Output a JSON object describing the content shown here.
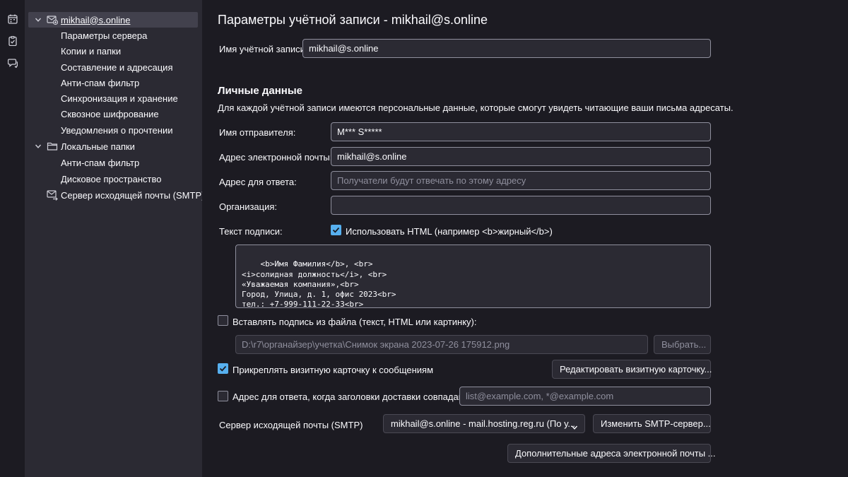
{
  "spaces": {
    "icons": [
      "calendar-icon",
      "tasks-icon",
      "chat-icon"
    ]
  },
  "tree": {
    "account": "mikhail@s.online",
    "account_items": [
      "Параметры сервера",
      "Копии и папки",
      "Составление и адресация",
      "Анти-спам фильтр",
      "Синхронизация и хранение",
      "Сквозное шифрование",
      "Уведомления о прочтении"
    ],
    "local_folders": "Локальные папки",
    "local_items": [
      "Анти-спам фильтр",
      "Дисковое пространство"
    ],
    "smtp": "Сервер исходящей почты (SMTP)"
  },
  "main": {
    "title": "Параметры учётной записи - mikhail@s.online",
    "account_name_label": "Имя учётной записи:",
    "account_name_value": "mikhail@s.online",
    "personal_title": "Личные данные",
    "personal_desc": "Для каждой учётной записи имеются персональные данные, которые смогут увидеть читающие ваши письма адресаты.",
    "sender_name_label": "Имя отправителя:",
    "sender_name_value": "M*** S*****",
    "email_label": "Адрес электронной почты:",
    "email_value": "mikhail@s.online",
    "reply_to_label": "Адрес для ответа:",
    "reply_to_placeholder": "Получатели будут отвечать по этому адресу",
    "org_label": "Организация:",
    "org_value": "",
    "signature_label": "Текст подписи:",
    "use_html_label": "Использовать HTML (например <b>жирный</b>)",
    "use_html_checked": true,
    "signature_text": "<b>Имя Фамилия</b>, <br>\n<i>солидная должность</i>, <br>\n«Уважаемая компания»,<br>\nГород, Улица, д. 1, офис 2023<br>\nтел.: +7-999-111-22-33<br>\nemail: <a href=\"mailto:mail@domen.ru\">mail@domen.ru</a>",
    "sig_file_label": "Вставлять подпись из файла (текст, HTML или картинку):",
    "sig_file_checked": false,
    "sig_file_path": "D:\\r7\\органайзер\\учетка\\Снимок экрана 2023-07-26 175912.png",
    "choose_button": "Выбрать...",
    "vcard_label": "Прикреплять визитную карточку к сообщениям",
    "vcard_checked": true,
    "edit_vcard_button": "Редактировать визитную карточку...",
    "reply_headers_label": "Адрес для ответа, когда заголовки доставки совпадают:",
    "reply_headers_checked": false,
    "reply_headers_placeholder": "list@example.com, *@example.com",
    "smtp_label": "Сервер исходящей почты (SMTP)",
    "smtp_value": "mikhail@s.online - mail.hosting.reg.ru (По у...",
    "change_smtp_button": "Изменить SMTP-сервер...",
    "additional_addresses_button": "Дополнительные адреса электронной почты ..."
  },
  "colors": {
    "background": "#1c1b22",
    "panel": "#2b2a33",
    "accent": "#57b0ef",
    "selected": "#42414d"
  }
}
